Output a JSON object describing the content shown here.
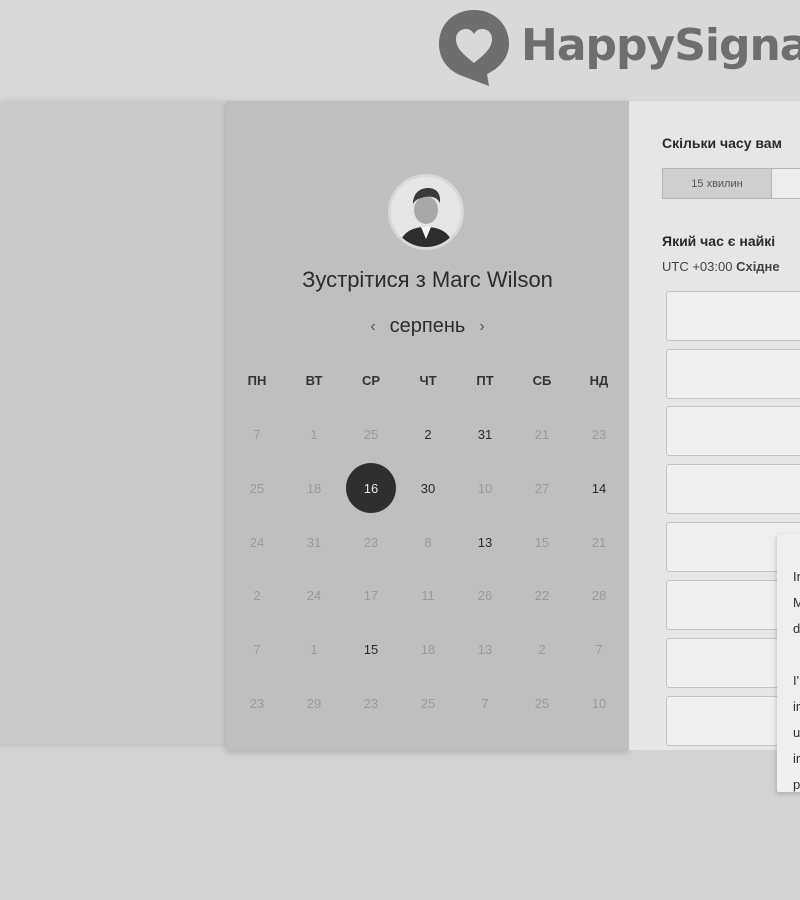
{
  "brand": {
    "name": "HappySignal",
    "color": "#6e6e6e"
  },
  "scheduler": {
    "title": "Зустрітися з Marc Wilson",
    "avatar_icon": "person-avatar-icon",
    "month": "серпень",
    "prev_icon": "chevron-left-icon",
    "next_icon": "chevron-right-icon",
    "weekdays": [
      "ПН",
      "ВТ",
      "СР",
      "ЧТ",
      "ПТ",
      "СБ",
      "НД"
    ],
    "weeks": [
      [
        {
          "d": "7",
          "on": false
        },
        {
          "d": "1",
          "on": false
        },
        {
          "d": "25",
          "on": false
        },
        {
          "d": "2",
          "on": true
        },
        {
          "d": "31",
          "on": true
        },
        {
          "d": "21",
          "on": false
        },
        {
          "d": "23",
          "on": false
        }
      ],
      [
        {
          "d": "25",
          "on": false
        },
        {
          "d": "18",
          "on": false
        },
        {
          "d": "16",
          "on": true,
          "sel": true
        },
        {
          "d": "30",
          "on": true
        },
        {
          "d": "10",
          "on": false
        },
        {
          "d": "27",
          "on": false
        },
        {
          "d": "14",
          "on": true
        }
      ],
      [
        {
          "d": "24",
          "on": false
        },
        {
          "d": "31",
          "on": false
        },
        {
          "d": "23",
          "on": false
        },
        {
          "d": "8",
          "on": false
        },
        {
          "d": "13",
          "on": true
        },
        {
          "d": "15",
          "on": false
        },
        {
          "d": "21",
          "on": false
        }
      ],
      [
        {
          "d": "2",
          "on": false
        },
        {
          "d": "24",
          "on": false
        },
        {
          "d": "17",
          "on": false
        },
        {
          "d": "11",
          "on": false
        },
        {
          "d": "26",
          "on": false
        },
        {
          "d": "22",
          "on": false
        },
        {
          "d": "28",
          "on": false
        }
      ],
      [
        {
          "d": "7",
          "on": false
        },
        {
          "d": "1",
          "on": false
        },
        {
          "d": "15",
          "on": true
        },
        {
          "d": "18",
          "on": false
        },
        {
          "d": "13",
          "on": false
        },
        {
          "d": "2",
          "on": false
        },
        {
          "d": "7",
          "on": false
        }
      ],
      [
        {
          "d": "23",
          "on": false
        },
        {
          "d": "29",
          "on": false
        },
        {
          "d": "23",
          "on": false
        },
        {
          "d": "25",
          "on": false
        },
        {
          "d": "7",
          "on": false
        },
        {
          "d": "25",
          "on": false
        },
        {
          "d": "10",
          "on": false
        }
      ]
    ],
    "selected_color": "#2f2f2f"
  },
  "booking": {
    "duration_question": "Скільки часу вам",
    "duration_options": [
      "15 хвилин",
      ""
    ],
    "time_question": "Який час є найкі",
    "timezone_offset": "UTC +03:00",
    "timezone_name": "Східне",
    "slot_count": 8
  },
  "popup": {
    "lines": [
      "Ir",
      "M",
      "d",
      "",
      "I'",
      "ir",
      "u",
      "ir",
      "p"
    ]
  }
}
